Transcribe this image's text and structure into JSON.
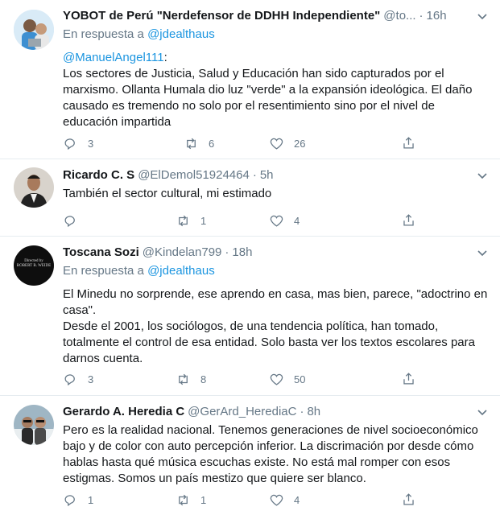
{
  "tweets": [
    {
      "name": "YOBOT de Perú \"Nerdefensor de DDHH Independiente\"",
      "handle": "@to...",
      "time": "16h",
      "reply_prefix": "En respuesta a",
      "reply_mention": "@jdealthaus",
      "mention": "@ManuelAngel111",
      "text": ":\nLos sectores de Justicia, Salud y Educación han sido capturados por el marxismo. Ollanta Humala dio luz \"verde\" a la expansión ideológica. El daño causado es tremendo no solo por el resentimiento sino por el nivel de educación impartida",
      "replies": "3",
      "retweets": "6",
      "likes": "26"
    },
    {
      "name": "Ricardo C. S",
      "handle": "@ElDemol51924464",
      "time": "5h",
      "text": "También el sector cultural, mi estimado",
      "replies": "",
      "retweets": "1",
      "likes": "4"
    },
    {
      "name": "Toscana Sozi",
      "handle": "@Kindelan799",
      "time": "18h",
      "reply_prefix": "En respuesta a",
      "reply_mention": "@jdealthaus",
      "avatar_text": "Directed by\nROBERT B. WEIDE",
      "text": "El Minedu no sorprende, ese aprendo en casa, mas bien, parece, \"adoctrino en casa\".\nDesde el 2001, los sociólogos, de una tendencia política, han tomado, totalmente el control de esa entidad. Solo basta ver los textos escolares para darnos cuenta.",
      "replies": "3",
      "retweets": "8",
      "likes": "50"
    },
    {
      "name": "Gerardo A. Heredia C",
      "handle": "@GerArd_HerediaC",
      "time": "8h",
      "text": "Pero es la realidad nacional. Tenemos generaciones de nivel socioeconómico bajo y de color con auto percepción inferior. La discrimación por desde cómo hablas hasta qué música escuchas existe. No está mal romper con esos estigmas. Somos un país mestizo que quiere ser blanco.",
      "replies": "1",
      "retweets": "1",
      "likes": "4"
    }
  ],
  "colors": {
    "link": "#1b95e0",
    "muted": "#657786",
    "text": "#14171a",
    "border": "#e6ecf0"
  },
  "icons": {
    "reply": "reply-icon",
    "retweet": "retweet-icon",
    "like": "heart-icon",
    "share": "share-icon",
    "more": "chevron-down-icon"
  },
  "dot": "·"
}
